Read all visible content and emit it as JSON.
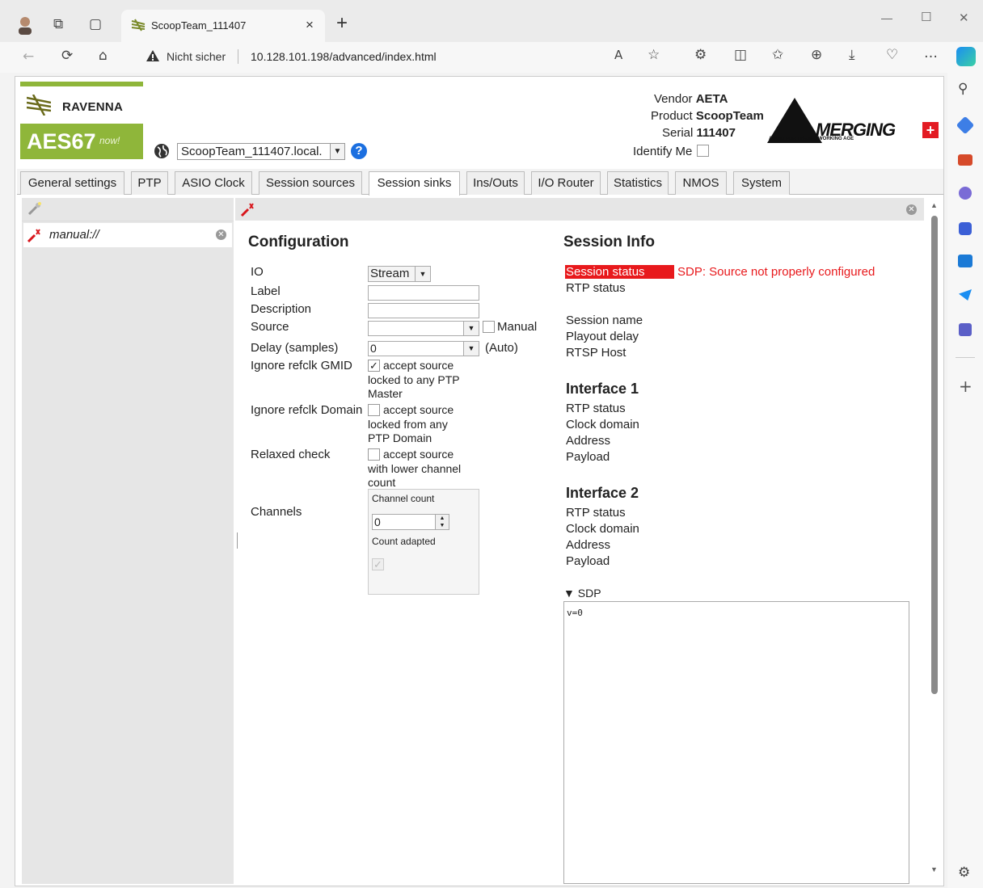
{
  "browser": {
    "tab_title": "ScoopTeam_111407",
    "close_tab": "×",
    "new_tab": "+",
    "security_label": "Nicht sicher",
    "url": "10.128.101.198/advanced/index.html",
    "min": "—",
    "max": "☐",
    "close": "✕"
  },
  "header": {
    "ravenna": "RAVENNA",
    "aes67": "AES67",
    "now": "now!",
    "device_select": "ScoopTeam_111407.local.",
    "help": "?",
    "vendor_label": "Vendor",
    "vendor_value": "AETA",
    "product_label": "Product",
    "product_value": "ScoopTeam",
    "serial_label": "Serial",
    "serial_value": "111407",
    "identify_label": "Identify Me",
    "merging": "MERGING",
    "merging_tagline": "AUDIO FOR THE NETWORKING AGE"
  },
  "tabs": [
    "General settings",
    "PTP",
    "ASIO Clock",
    "Session sources",
    "Session sinks",
    "Ins/Outs",
    "I/O Router",
    "Statistics",
    "NMOS",
    "System"
  ],
  "sink_list": {
    "item": "manual://"
  },
  "config": {
    "title": "Configuration",
    "io_label": "IO",
    "io_value": "Stream",
    "label_label": "Label",
    "description_label": "Description",
    "source_label": "Source",
    "manual_label": "Manual",
    "delay_label": "Delay (samples)",
    "delay_value": "0",
    "auto_label": "(Auto)",
    "gmid_label": "Ignore refclk GMID",
    "gmid_text_1": "accept source",
    "gmid_text_2": "locked to any PTP",
    "gmid_text_3": "Master",
    "domain_label": "Ignore refclk Domain",
    "domain_text_1": "accept source",
    "domain_text_2": "locked from any",
    "domain_text_3": "PTP Domain",
    "relaxed_label": "Relaxed check",
    "relaxed_text_1": "accept source",
    "relaxed_text_2": "with lower channel",
    "relaxed_text_3": "count",
    "channels_label": "Channels",
    "channel_count_label": "Channel count",
    "channel_count_value": "0",
    "count_adapted_label": "Count adapted"
  },
  "session_info": {
    "title": "Session Info",
    "session_status_label": "Session status",
    "session_status_value": "SDP: Source not properly configured",
    "rtp_status_label": "RTP status",
    "session_name_label": "Session name",
    "playout_delay_label": "Playout delay",
    "rtsp_host_label": "RTSP Host",
    "interface1_title": "Interface 1",
    "interface2_title": "Interface 2",
    "clock_domain_label": "Clock domain",
    "address_label": "Address",
    "payload_label": "Payload",
    "sdp_label": "▼ SDP",
    "sdp_text": "v=0"
  },
  "colors": {
    "ravenna_green": "#8fb63a",
    "status_red": "#e8191c",
    "merging_red": "#e31b23"
  }
}
